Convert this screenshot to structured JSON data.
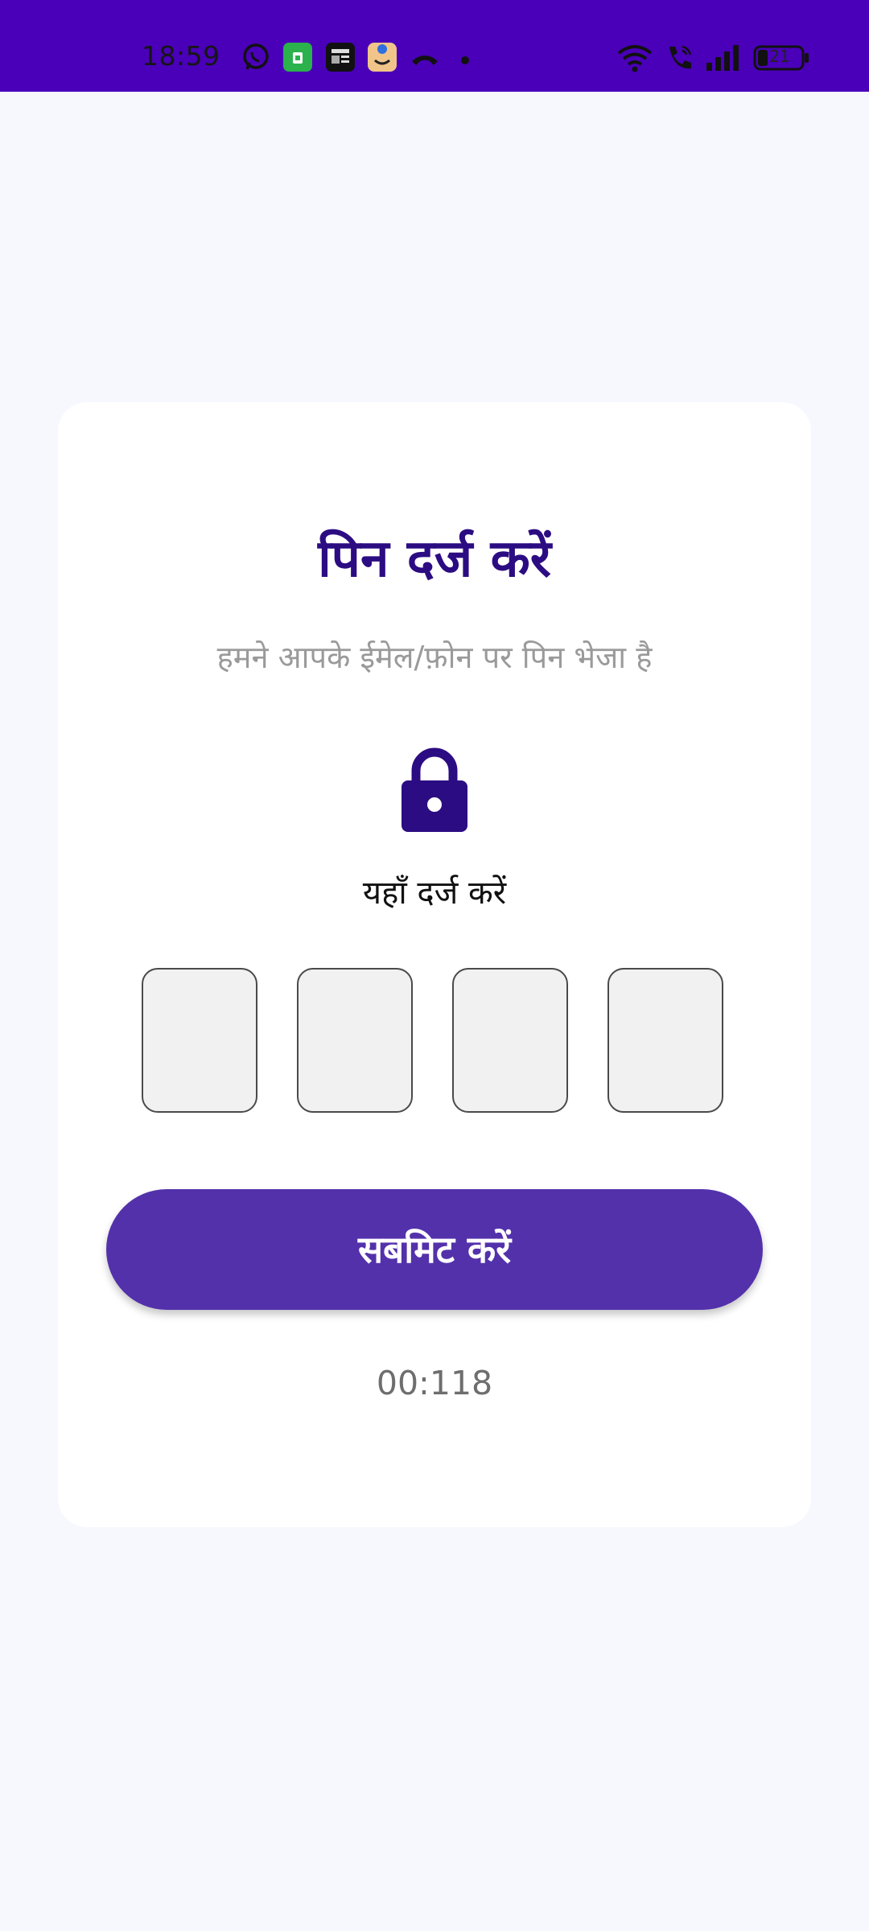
{
  "status_bar": {
    "time": "18:59",
    "battery_level": "21",
    "icons": [
      "whatsapp-icon",
      "green-shop-icon",
      "news-app-icon",
      "shopping-app-icon",
      "missed-call-icon",
      "dot-icon",
      "wifi-icon",
      "wifi-calling-icon",
      "signal-icon",
      "battery-icon"
    ],
    "background_color": "#4a00b8"
  },
  "pin_card": {
    "title": "पिन दर्ज करें",
    "subtitle": "हमने आपके ईमेल/फ़ोन पर पिन भेजा है",
    "lock_icon": "lock-icon",
    "hint": "यहाँ दर्ज करें",
    "pin_fields": [
      {
        "value": ""
      },
      {
        "value": ""
      },
      {
        "value": ""
      },
      {
        "value": ""
      }
    ],
    "submit_label": "सबमिट करें",
    "timer": "00:118"
  },
  "colors": {
    "accent": "#5331ab",
    "title": "#2c0c82",
    "page_background": "#f7f8fd"
  }
}
